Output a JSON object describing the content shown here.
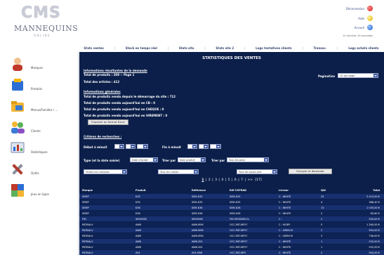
{
  "header": {
    "logo": {
      "line1": "CMS",
      "line2": "MANNEQUINS",
      "line3": "ONLINE"
    },
    "logout_label": "Déconnexion",
    "help_label": "Aide",
    "home_label": "Accueil",
    "session_info": "10 minutes 10 secondes"
  },
  "navbar": {
    "items": [
      "Stats ventes",
      "Stock en temps réel",
      "Stats site",
      "Stats site 2",
      "Logs tentatives clients",
      "Transac.",
      "Logs achats clients"
    ]
  },
  "sidebar": {
    "items": [
      {
        "label": "Marques",
        "icon": "user-icon"
      },
      {
        "label": "Produits",
        "icon": "product-icon"
      },
      {
        "label": "Menus/Familles / ...",
        "icon": "folder-icon"
      },
      {
        "label": "Clients",
        "icon": "users-icon"
      },
      {
        "label": "Statistiques",
        "icon": "stats-icon"
      },
      {
        "label": "Outils",
        "icon": "tools-icon"
      },
      {
        "label": "Jeux en ligne",
        "icon": "puzzle-icon"
      }
    ]
  },
  "content": {
    "title": "STATISTIQUES DES VENTES",
    "section1_title": "Informations résultantes de la demande",
    "total_products": "Total de produits : 208 -- Page 1",
    "total_articles": "Total des articles : 412",
    "pagination_label": "Pagination",
    "pagination_value": "10 par page",
    "section2_title": "Informations générales",
    "general_info": [
      "Total de produits vendu depuis le démarrage du site : 712",
      "Total de produits vendu aujourd'hui en CB : 0",
      "Total de produits vendu aujourd'hui en CHEQUE : 0",
      "Total de produits vendu aujourd'hui en VIREMENT : 0"
    ],
    "export_button": "Exporter au format Excel",
    "criteria_title": "Critères de recherches :",
    "date_from_label": "Début à minuit",
    "date_to_label": "Fin à minuit",
    "type_label": "Type (et la date saisie)",
    "type_value": "Date d'achat",
    "sort_label1": "Trier par",
    "sort_value1": "Nom produit",
    "sort_label2": "Trier par",
    "sort_value2": "Tous les pays",
    "filter_brands": "Toutes les marques",
    "filter_clients": "Tous les clients",
    "filter_payment": "Tous les types pmt",
    "submit_button": "Envoyer la demande",
    "pager": [
      "1",
      "2",
      "3",
      "4",
      "5",
      "6",
      "7",
      ">>",
      "[17]"
    ]
  },
  "table": {
    "columns": [
      "Marque",
      "Produit",
      "Référence",
      "Réf COFRAD",
      "Livreur",
      "Qté",
      "Total"
    ],
    "rows": [
      [
        "SEMP",
        "K35",
        "SEM-K35",
        "SEM-K35",
        "C : WHITE",
        "25",
        "2 415,00 €"
      ],
      [
        "SEMP",
        "K35",
        "SEM-K35",
        "SEM-K35",
        "C : WHITE",
        "4",
        "386,40 €"
      ],
      [
        "SEMP",
        "K36",
        "SEM-K36",
        "SEM-K36",
        "C : WHITE",
        "15",
        "1 035,00 €"
      ],
      [
        "SEMP",
        "K36",
        "SEM-K36",
        "SEM-K36",
        "C : WHITE",
        "2",
        "65,80 €"
      ],
      [
        "FID",
        "96500SB",
        "96500SB",
        "FID-96500SB.CL",
        "C :",
        "2",
        "550,00 €"
      ],
      [
        "PATINA-V",
        "AW6",
        "AW6-M56",
        "OCC-PAT-MF57",
        "C : IVORY",
        "5",
        "1 260,00 €"
      ],
      [
        "PATINA-V",
        "AW6",
        "AW6-M56",
        "OCC-PAT-MF57",
        "C : GREN M",
        "2",
        "504,00 €"
      ],
      [
        "PATINA-V",
        "AW6",
        "AW6-M56",
        "OCC-PAT-MF57",
        "C : GREN M",
        "3",
        "756,00 €"
      ],
      [
        "PATINA-V",
        "AW6",
        "AW6-2K1",
        "OCC-PAT-MF57",
        "C : WHITE",
        "1",
        "252,00 €"
      ],
      [
        "PATINA-V",
        "AW6",
        "AW6-2K1",
        "OCC-PAT-MF57",
        "C : WHITE",
        "1",
        "252,00 €"
      ],
      [
        "PATINA-V",
        "AY4",
        "AY4-M56",
        "OCC-PAT-MF5",
        "C : WHITE",
        "2",
        "504,00 €"
      ]
    ]
  },
  "colors": {
    "content_bg": "#0b1f4a",
    "row_odd": "#173070",
    "row_even": "#0e2355",
    "accent": "#3d5aa8"
  }
}
